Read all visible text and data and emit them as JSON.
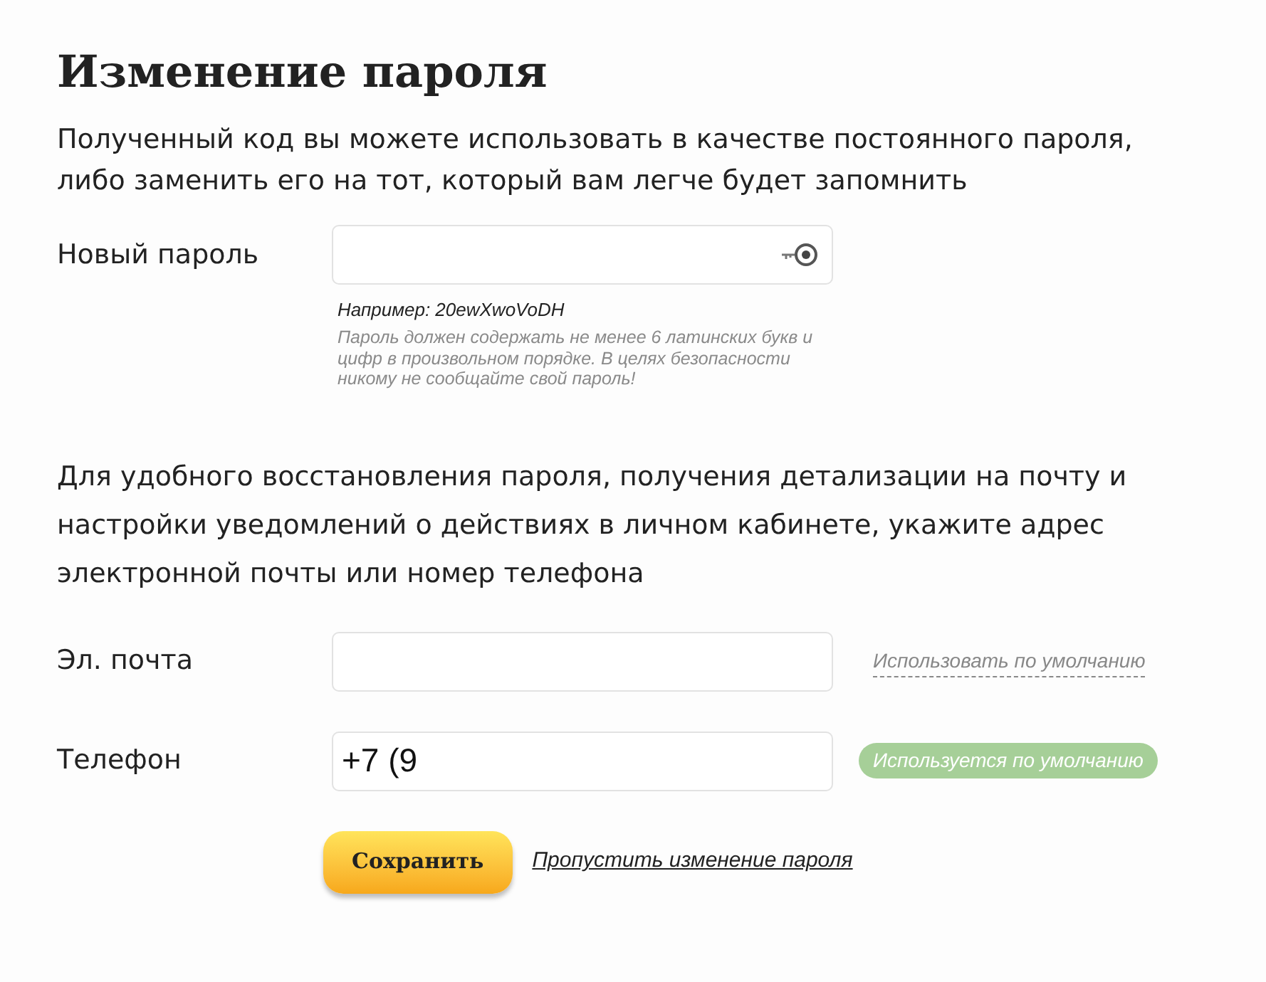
{
  "title": "Изменение пароля",
  "intro": "Полученный код вы можете использовать в качестве постоянного пароля, либо заменить его на тот, который вам легче будет запомнить",
  "password": {
    "label": "Новый пароль",
    "example": "Например: 20ewXwoVoDH",
    "hint": "Пароль должен содержать не менее 6 латинских букв и цифр в произвольном порядке. В целях безопасности никому не сообщайте свой пароль!"
  },
  "contact_intro": "Для удобного восстановления пароля, получения детализации на почту и настройки уведомлений о действиях в личном кабинете, укажите адрес электронной почты или номер телефона",
  "contacts": [
    {
      "label": "Эл. почта",
      "default": false,
      "default_text": "Использовать по умолчанию"
    },
    {
      "label": "Телефон",
      "value": "+7 (9",
      "default": true,
      "default_text": "Используется по умолчанию"
    }
  ],
  "save_button": "Сохранить",
  "skip_link": "Пропустить изменение пароля"
}
